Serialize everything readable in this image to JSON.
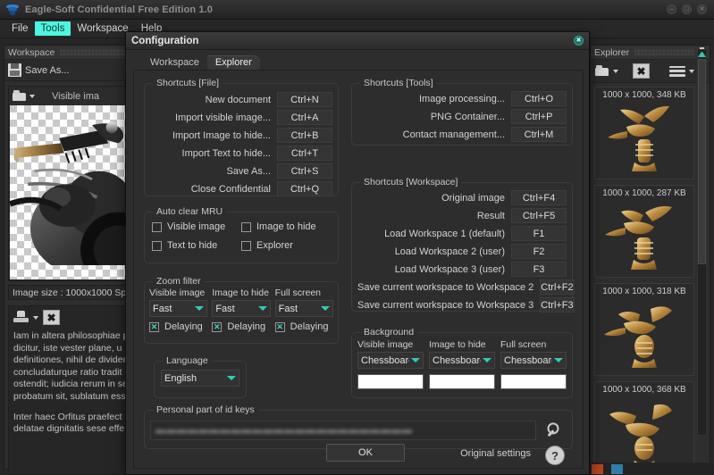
{
  "window": {
    "title": "Eagle-Soft Confidential Free Edition 1.0",
    "icon": "stack-icon",
    "buttons": [
      {
        "name": "minimize",
        "glyph": "–"
      },
      {
        "name": "maximize",
        "glyph": "□"
      },
      {
        "name": "close",
        "glyph": "✕"
      }
    ]
  },
  "menubar": {
    "items": [
      {
        "label": "File",
        "active": false
      },
      {
        "label": "Tools",
        "active": true
      },
      {
        "label": "Workspace",
        "active": false
      },
      {
        "label": "Help",
        "active": false
      }
    ],
    "active_color": "#4ff5e0"
  },
  "workspace_panel": {
    "title": "Workspace",
    "save_as_label": "Save As...",
    "visible_image_label": "Visible ima",
    "status": "Image size : 1000x1000  Sp",
    "text_panel": {
      "paragraphs": [
        "Iam in altera philosophiae p dicitur, iste vester plane, u definitiones, nihil de divider concludaturque ratio tradit ostendit; iudicia rerum in se probatum sit, sublatum ess",
        "Inter haec Orfitus praefect delatae dignitatis sese effe"
      ]
    }
  },
  "explorer_panel": {
    "title": "Explorer",
    "thumbnails": [
      {
        "label": "1000 x 1000, 348 KB"
      },
      {
        "label": "1000 x 1000, 287 KB"
      },
      {
        "label": "1000 x 1000, 318 KB"
      },
      {
        "label": "1000 x 1000, 368 KB"
      }
    ]
  },
  "dialog": {
    "title": "Configuration",
    "tabs": [
      {
        "label": "Workspace",
        "selected": false
      },
      {
        "label": "Explorer",
        "selected": true
      }
    ],
    "shortcuts_file": {
      "legend": "Shortcuts [File]",
      "rows": [
        {
          "name": "New document",
          "key": "Ctrl+N"
        },
        {
          "name": "Import visible image...",
          "key": "Ctrl+A"
        },
        {
          "name": "Import Image to hide...",
          "key": "Ctrl+B"
        },
        {
          "name": "Import Text to hide...",
          "key": "Ctrl+T"
        },
        {
          "name": "Save As...",
          "key": "Ctrl+S"
        },
        {
          "name": "Close Confidential",
          "key": "Ctrl+Q"
        }
      ]
    },
    "shortcuts_tools": {
      "legend": "Shortcuts [Tools]",
      "rows": [
        {
          "name": "Image processing...",
          "key": "Ctrl+O"
        },
        {
          "name": "PNG Container...",
          "key": "Ctrl+P"
        },
        {
          "name": "Contact management...",
          "key": "Ctrl+M"
        }
      ]
    },
    "shortcuts_workspace": {
      "legend": "Shortcuts [Workspace]",
      "rows": [
        {
          "name": "Original image",
          "key": "Ctrl+F4"
        },
        {
          "name": "Result",
          "key": "Ctrl+F5"
        },
        {
          "name": "Load Workspace 1 (default)",
          "key": "F1"
        },
        {
          "name": "Load Workspace 2 (user)",
          "key": "F2"
        },
        {
          "name": "Load Workspace 3 (user)",
          "key": "F3"
        },
        {
          "name": "Save current workspace to Workspace 2",
          "key": "Ctrl+F2"
        },
        {
          "name": "Save current workspace to Workspace 3",
          "key": "Ctrl+F3"
        }
      ]
    },
    "auto_clear_mru": {
      "legend": "Auto clear MRU",
      "items": [
        {
          "label": "Visible image",
          "checked": false
        },
        {
          "label": "Image to hide",
          "checked": false
        },
        {
          "label": "Text to hide",
          "checked": false
        },
        {
          "label": "Explorer",
          "checked": false
        }
      ]
    },
    "zoom_filter": {
      "legend": "Zoom filter",
      "columns": [
        {
          "label": "Visible image",
          "value": "Fast",
          "delay_label": "Delaying",
          "delay_checked": true
        },
        {
          "label": "Image to hide",
          "value": "Fast",
          "delay_label": "Delaying",
          "delay_checked": true
        },
        {
          "label": "Full screen",
          "value": "Fast",
          "delay_label": "Delaying",
          "delay_checked": true
        }
      ]
    },
    "language": {
      "legend": "Language",
      "value": "English"
    },
    "id_keys": {
      "legend": "Personal part of id keys",
      "value": "▬▬▬▬▬▬▬▬▬▬▬▬▬▬▬▬▬▬▬▬▬▬▬▬",
      "button_icon": "key-icon"
    },
    "background": {
      "legend": "Background",
      "columns": [
        {
          "label": "Visible image",
          "value": "Chessboard",
          "swatch": "#ffffff"
        },
        {
          "label": "Image to hide",
          "value": "Chessboard",
          "swatch": "#ffffff"
        },
        {
          "label": "Full screen",
          "value": "Chessboard",
          "swatch": "#ffffff"
        }
      ]
    },
    "footer": {
      "ok_label": "OK",
      "original_settings_label": "Original settings",
      "help_label": "?"
    }
  }
}
